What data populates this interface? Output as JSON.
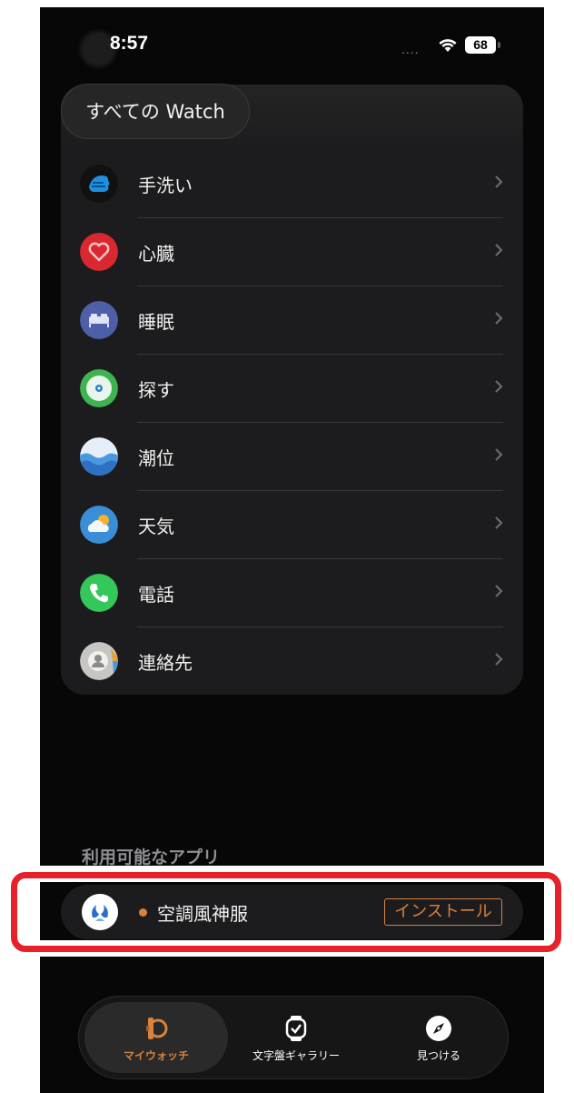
{
  "status_bar": {
    "time": "8:57",
    "signal": "....",
    "battery": "68"
  },
  "header": {
    "watch_switch_label": "すべての Watch"
  },
  "apps_list": [
    {
      "label": "手洗い",
      "icon": "handwashing-icon",
      "color": "#1f8fe0"
    },
    {
      "label": "心臓",
      "icon": "heart-icon",
      "color": "#d9282f"
    },
    {
      "label": "睡眠",
      "icon": "bed-icon",
      "color": "#4d5fa8"
    },
    {
      "label": "探す",
      "icon": "findmy-icon",
      "color": "#3fb34f"
    },
    {
      "label": "潮位",
      "icon": "tides-icon",
      "color": "#2f7fd0"
    },
    {
      "label": "天気",
      "icon": "weather-icon",
      "color": "#3a8ed8"
    },
    {
      "label": "電話",
      "icon": "phone-icon",
      "color": "#34c759"
    },
    {
      "label": "連絡先",
      "icon": "contacts-icon",
      "color": "#9a9a9a"
    }
  ],
  "available_apps": {
    "header": "利用可能なアプリ",
    "items": [
      {
        "name": "空調風神服",
        "install_label": "インストール",
        "icon": "kucho-fujin-app-icon"
      }
    ]
  },
  "tab_bar": {
    "tabs": [
      {
        "label": "マイウォッチ",
        "icon": "watch-side-icon",
        "active": true
      },
      {
        "label": "文字盤ギャラリー",
        "icon": "watch-face-icon",
        "active": false
      },
      {
        "label": "見つける",
        "icon": "compass-icon",
        "active": false
      }
    ]
  },
  "colors": {
    "accent": "#d9823b",
    "highlight": "#e62129"
  }
}
